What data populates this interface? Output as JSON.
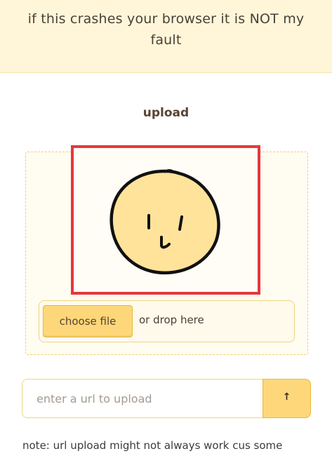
{
  "banner": {
    "text": "if this crashes your browser it is NOT my fault"
  },
  "upload_section": {
    "title": "upload",
    "preview": {
      "icon": "smiley-face-drawing",
      "colors": {
        "face_fill": "#ffe39a",
        "outline": "#111111",
        "highlight_border": "#e5383b"
      }
    },
    "file_picker": {
      "button_label": "choose file",
      "drop_hint": "or drop here"
    }
  },
  "url_upload": {
    "placeholder": "enter a url to upload",
    "value": "",
    "submit_icon": "upload-arrow-icon",
    "submit_symbol": "↑"
  },
  "note": {
    "text": "note: url upload might not always work cus some"
  },
  "colors": {
    "accent": "#fdd77a",
    "banner_bg": "#fff6da",
    "border": "#f0d582"
  }
}
